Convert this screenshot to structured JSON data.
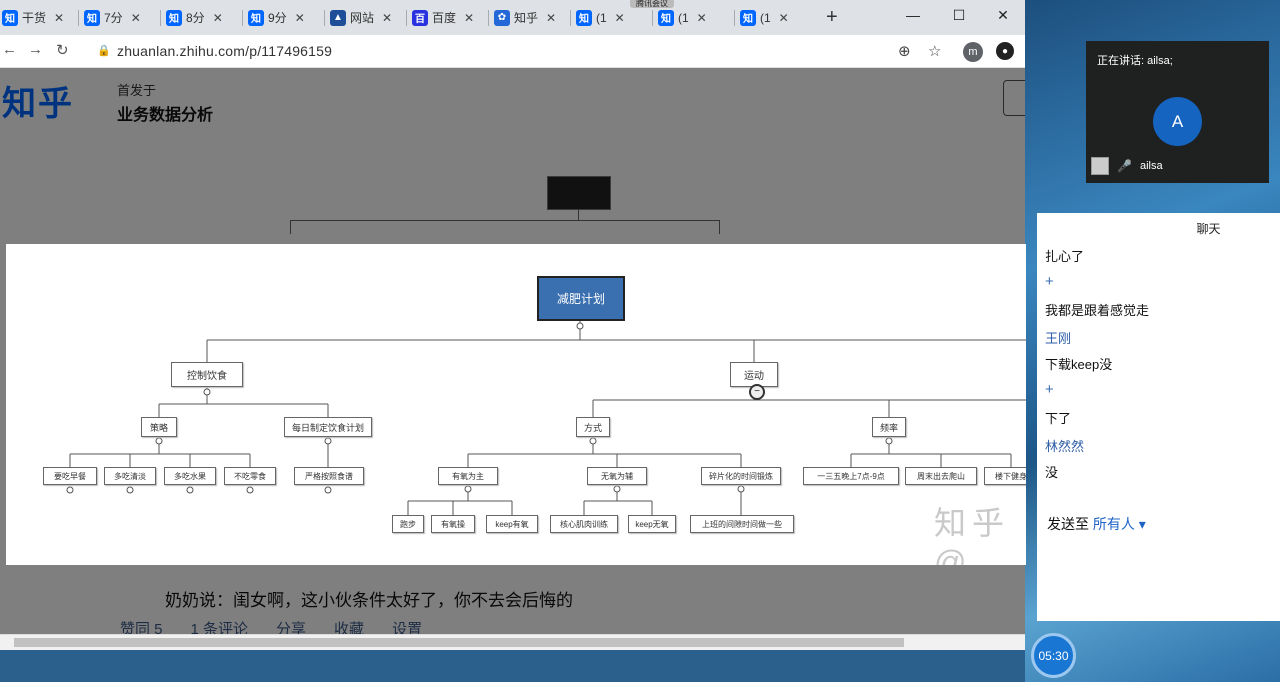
{
  "browser": {
    "tabs": [
      {
        "icon": "知",
        "title": "干货",
        "color": "#0066ff"
      },
      {
        "icon": "知",
        "title": "7分",
        "color": "#0066ff"
      },
      {
        "icon": "知",
        "title": "8分",
        "color": "#0066ff"
      },
      {
        "icon": "知",
        "title": "9分",
        "color": "#0066ff"
      },
      {
        "icon": "chart-icon",
        "title": "网站",
        "color": "#1f4e99"
      },
      {
        "icon": "百",
        "title": "百度",
        "color": "#2932e1"
      },
      {
        "icon": "paw-icon",
        "title": "知乎",
        "color": "#2468d8"
      },
      {
        "icon": "知",
        "title": "(1",
        "color": "#0066ff"
      },
      {
        "icon": "知",
        "title": "(1",
        "color": "#0066ff"
      },
      {
        "icon": "知",
        "title": "(1",
        "color": "#0066ff"
      }
    ],
    "new_tab": "+",
    "tooltip": "腾讯会议",
    "window": {
      "minimize": "—",
      "maximize": "☐",
      "close": "✕"
    },
    "url": "zhuanlan.zhihu.com/p/117496159",
    "profile_initial": "m"
  },
  "page": {
    "logo": "知乎",
    "published_in": "首发于",
    "column_name": "业务数据分析",
    "caption": "奶奶说：闺女啊，这小伙条件太好了，你不去会后悔的",
    "actions": [
      "赞同 5",
      "1 条评论",
      "分享",
      "收藏",
      "设置"
    ]
  },
  "mindmap": {
    "root": "减肥计划",
    "watermark": "知乎 @",
    "level1": [
      "控制饮食",
      "运动"
    ],
    "diet_children": [
      "策略",
      "每日制定饮食计划"
    ],
    "strategy_items": [
      "要吃早餐",
      "多吃清淡",
      "多吃水果",
      "不吃零食"
    ],
    "plan_items": [
      "严格按照食谱"
    ],
    "sport_children": [
      "方式",
      "频率"
    ],
    "method_items": [
      "有氧为主",
      "无氧为辅",
      "碎片化的时间锻炼"
    ],
    "aerobic_items": [
      "跑步",
      "有氧操",
      "keep有氧"
    ],
    "anaerobic_items": [
      "核心肌肉训练",
      "keep无氧"
    ],
    "fragment_items": [
      "上班的间隙时间做一些"
    ],
    "freq_items": [
      "一三五晚上7点-9点",
      "周末出去爬山",
      "楼下健身"
    ]
  },
  "meeting": {
    "speaking_label": "正在讲话: ailsa;",
    "avatar_initial": "A",
    "user_name": "ailsa",
    "chat_title": "聊天",
    "messages": [
      {
        "type": "msg",
        "text": "扎心了"
      },
      {
        "type": "plus",
        "text": "+"
      },
      {
        "type": "msg",
        "text": "我都是跟着感觉走"
      },
      {
        "type": "name",
        "text": "王刚"
      },
      {
        "type": "msg",
        "text": "下载keep没"
      },
      {
        "type": "plus",
        "text": "+"
      },
      {
        "type": "msg",
        "text": "下了"
      },
      {
        "type": "name",
        "text": "林然然"
      },
      {
        "type": "msg",
        "text": "没"
      }
    ],
    "send_label": "发送至",
    "send_target": "所有人",
    "timer": "05:30"
  }
}
